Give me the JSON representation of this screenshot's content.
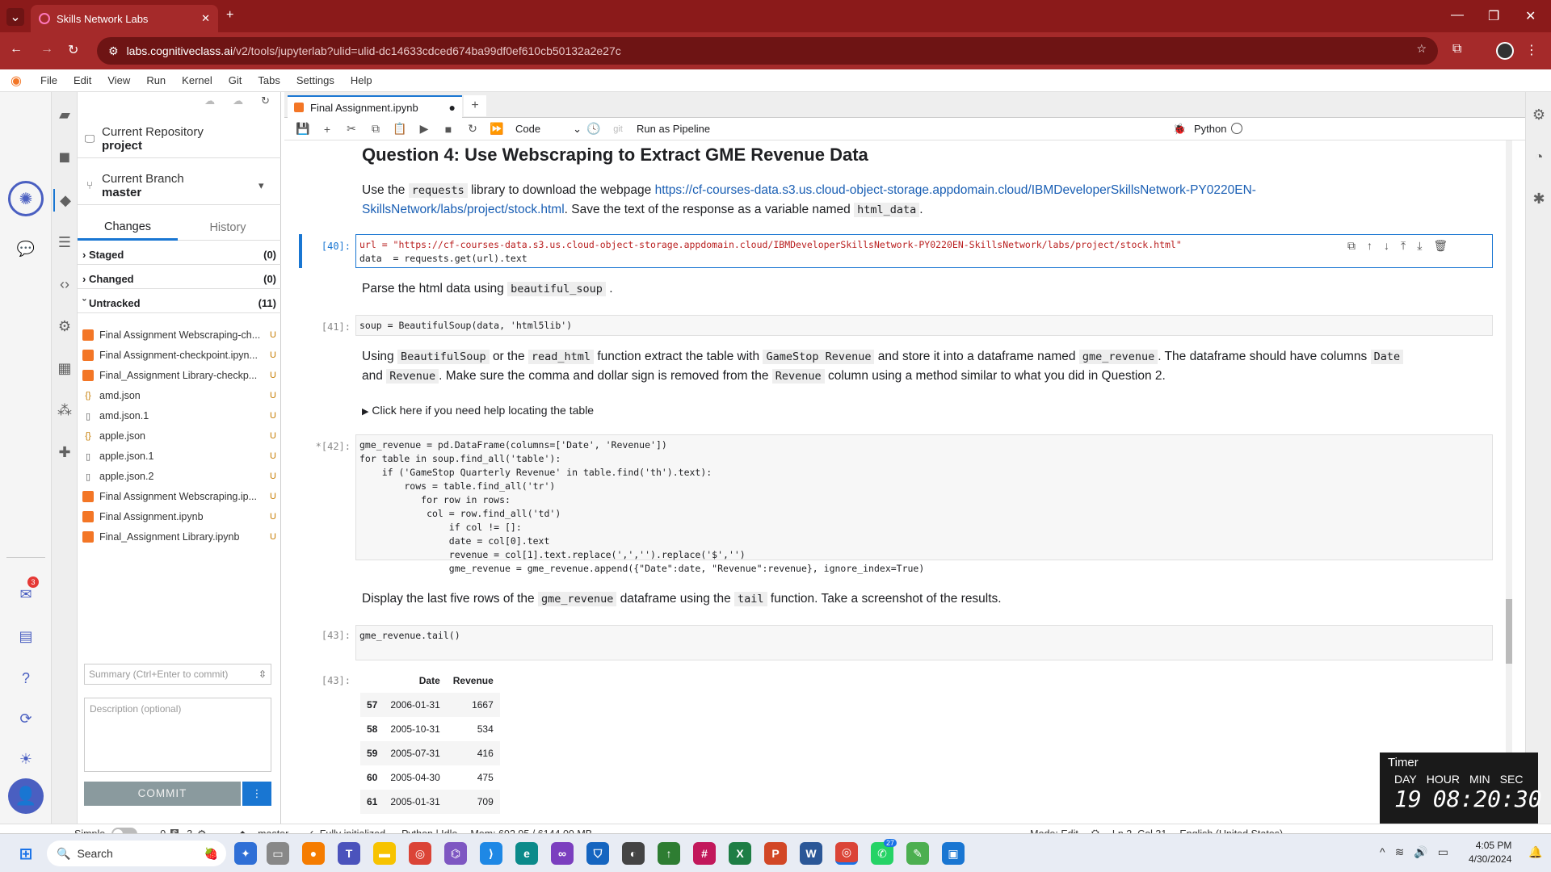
{
  "browser": {
    "tab_title": "Skills Network Labs",
    "url_host": "labs.cognitiveclass.ai",
    "url_path": "/v2/tools/jupyterlab?ulid=ulid-dc14633cdced674ba99df0ef610cb50132a2e27c"
  },
  "menu": [
    "File",
    "Edit",
    "View",
    "Run",
    "Kernel",
    "Git",
    "Tabs",
    "Settings",
    "Help"
  ],
  "git": {
    "repo_label": "Current Repository",
    "repo_name": "project",
    "branch_label": "Current Branch",
    "branch_name": "master",
    "tab_changes": "Changes",
    "tab_history": "History",
    "staged_label": "Staged",
    "staged_count": "(0)",
    "changed_label": "Changed",
    "changed_count": "(0)",
    "untracked_label": "Untracked",
    "untracked_count": "(11)",
    "files": [
      {
        "name": "Final Assignment Webscraping-ch...",
        "type": "nb",
        "status": "U"
      },
      {
        "name": "Final Assignment-checkpoint.ipyn...",
        "type": "nb",
        "status": "U"
      },
      {
        "name": "Final_Assignment Library-checkp...",
        "type": "nb",
        "status": "U"
      },
      {
        "name": "amd.json",
        "type": "json",
        "status": "U"
      },
      {
        "name": "amd.json.1",
        "type": "file",
        "status": "U"
      },
      {
        "name": "apple.json",
        "type": "json",
        "status": "U"
      },
      {
        "name": "apple.json.1",
        "type": "file",
        "status": "U"
      },
      {
        "name": "apple.json.2",
        "type": "file",
        "status": "U"
      },
      {
        "name": "Final Assignment Webscraping.ip...",
        "type": "nb",
        "status": "U"
      },
      {
        "name": "Final Assignment.ipynb",
        "type": "nb",
        "status": "U"
      },
      {
        "name": "Final_Assignment Library.ipynb",
        "type": "nb",
        "status": "U"
      }
    ],
    "summary_placeholder": "Summary (Ctrl+Enter to commit)",
    "description_placeholder": "Description (optional)",
    "commit_label": "COMMIT"
  },
  "notebook": {
    "tab_title": "Final Assignment.ipynb",
    "cell_type": "Code",
    "run_pipeline": "Run as Pipeline",
    "kernel": "Python",
    "heading": "Question 4: Use Webscraping to Extract GME Revenue Data",
    "p1_a": "Use the",
    "p1_code1": "requests",
    "p1_b": "library to download the webpage",
    "p1_link1": "https://cf-courses-data.s3.us.cloud-object-storage.appdomain.cloud/IBMDeveloperSkillsNetwork-PY0220EN-",
    "p1_link2": "SkillsNetwork/labs/project/stock.html",
    "p1_c": ". Save the text of the response as a variable named",
    "p1_code2": "html_data",
    "p1_d": ".",
    "c40_prompt": "[40]:",
    "c40_l1": "url = \"https://cf-courses-data.s3.us.cloud-object-storage.appdomain.cloud/IBMDeveloperSkillsNetwork-PY0220EN-SkillsNetwork/labs/project/stock.html\"",
    "c40_l2": "data  = requests.get(url).text",
    "p2_a": "Parse the html data using",
    "p2_code": "beautiful_soup",
    "p2_b": ".",
    "c41_prompt": "[41]:",
    "c41": "soup = BeautifulSoup(data, 'html5lib')",
    "p3_l1a": "Using",
    "p3_c1": "BeautifulSoup",
    "p3_l1b": "or the",
    "p3_c2": "read_html",
    "p3_l1c": "function extract the table with",
    "p3_c3": "GameStop Revenue",
    "p3_l1d": "and store it into a dataframe named",
    "p3_c4": "gme_revenue",
    "p3_l1e": ". The dataframe should have columns",
    "p3_c5": "Date",
    "p3_l2a": "and",
    "p3_c6": "Revenue",
    "p3_l2b": ". Make sure the comma and dollar sign is removed from the",
    "p3_c7": "Revenue",
    "p3_l2c": "column using a method similar to what you did in Question 2.",
    "details": "Click here if you need help locating the table",
    "c42_prompt": "*[42]:",
    "c42_lines": [
      "gme_revenue = pd.DataFrame(columns=['Date', 'Revenue'])",
      "for table in soup.find_all('table'):",
      "    if ('GameStop Quarterly Revenue' in table.find('th').text):",
      "        rows = table.find_all('tr')",
      "           for row in rows:",
      "            col = row.find_all('td')",
      "                if col != []:",
      "                date = col[0].text",
      "                revenue = col[1].text.replace(',','').replace('$','')",
      "                gme_revenue = gme_revenue.append({\"Date\":date, \"Revenue\":revenue}, ignore_index=True)"
    ],
    "p4_a": "Display the last five rows of the",
    "p4_c1": "gme_revenue",
    "p4_b": "dataframe using the",
    "p4_c2": "tail",
    "p4_c": "function. Take a screenshot of the results.",
    "c43_prompt": "[43]:",
    "c43": "gme_revenue.tail()",
    "out43_prompt": "[43]:",
    "table": {
      "headers": [
        "",
        "Date",
        "Revenue"
      ],
      "rows": [
        [
          "57",
          "2006-01-31",
          "1667"
        ],
        [
          "58",
          "2005-10-31",
          "534"
        ],
        [
          "59",
          "2005-07-31",
          "416"
        ],
        [
          "60",
          "2005-04-30",
          "475"
        ],
        [
          "61",
          "2005-01-31",
          "709"
        ]
      ]
    }
  },
  "status": {
    "simple": "Simple",
    "count1": "0",
    "count2": "3",
    "branch": "master",
    "init": "Fully initialized",
    "kernel": "Python | Idle",
    "mem": "Mem: 692.95 / 6144.00 MB",
    "mode": "Mode: Edit",
    "pos": "Ln 2, Col 31",
    "lang": "English (United States)"
  },
  "timer": {
    "title": "Timer",
    "labels": [
      "DAY",
      "HOUR",
      "MIN",
      "SEC"
    ],
    "day": "19",
    "hms": "08:20:30"
  },
  "taskbar": {
    "search": "Search",
    "time": "4:05 PM",
    "date": "4/30/2024",
    "badge_mail": "3",
    "badge_whatsapp": "27"
  }
}
